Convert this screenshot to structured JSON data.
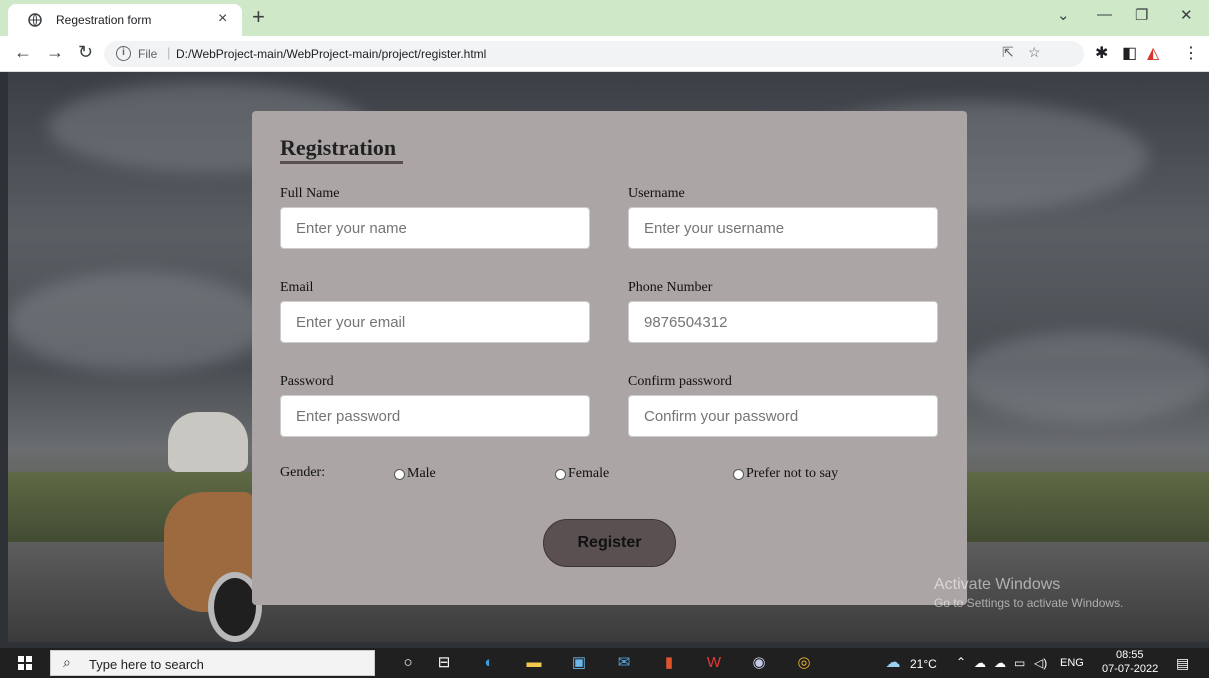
{
  "browser": {
    "tab_title": "Regestration form",
    "site_label": "File",
    "url": "D:/WebProject-main/WebProject-main/project/register.html"
  },
  "form": {
    "title": "Registration",
    "fields": [
      {
        "label": "Full Name",
        "placeholder": "Enter your name",
        "value": ""
      },
      {
        "label": "Username",
        "placeholder": "Enter your username",
        "value": ""
      },
      {
        "label": "Email",
        "placeholder": "Enter your email",
        "value": ""
      },
      {
        "label": "Phone Number",
        "placeholder": "9876504312",
        "value": ""
      },
      {
        "label": "Password",
        "placeholder": "Enter password",
        "value": ""
      },
      {
        "label": "Confirm password",
        "placeholder": "Confirm your password",
        "value": ""
      }
    ],
    "gender": {
      "label": "Gender:",
      "options": [
        "Male",
        "Female",
        "Prefer not to say"
      ]
    },
    "submit_label": "Register"
  },
  "watermark": {
    "title": "Activate Windows",
    "subtitle": "Go to Settings to activate Windows."
  },
  "taskbar": {
    "search_placeholder": "Type here to search",
    "weather": "21°C",
    "language": "ENG",
    "time": "08:55",
    "date": "07-07-2022"
  },
  "colors": {
    "tab_strip": "#cfe8c8",
    "card_bg": "#aba5a5",
    "button_bg": "#5a5051"
  }
}
